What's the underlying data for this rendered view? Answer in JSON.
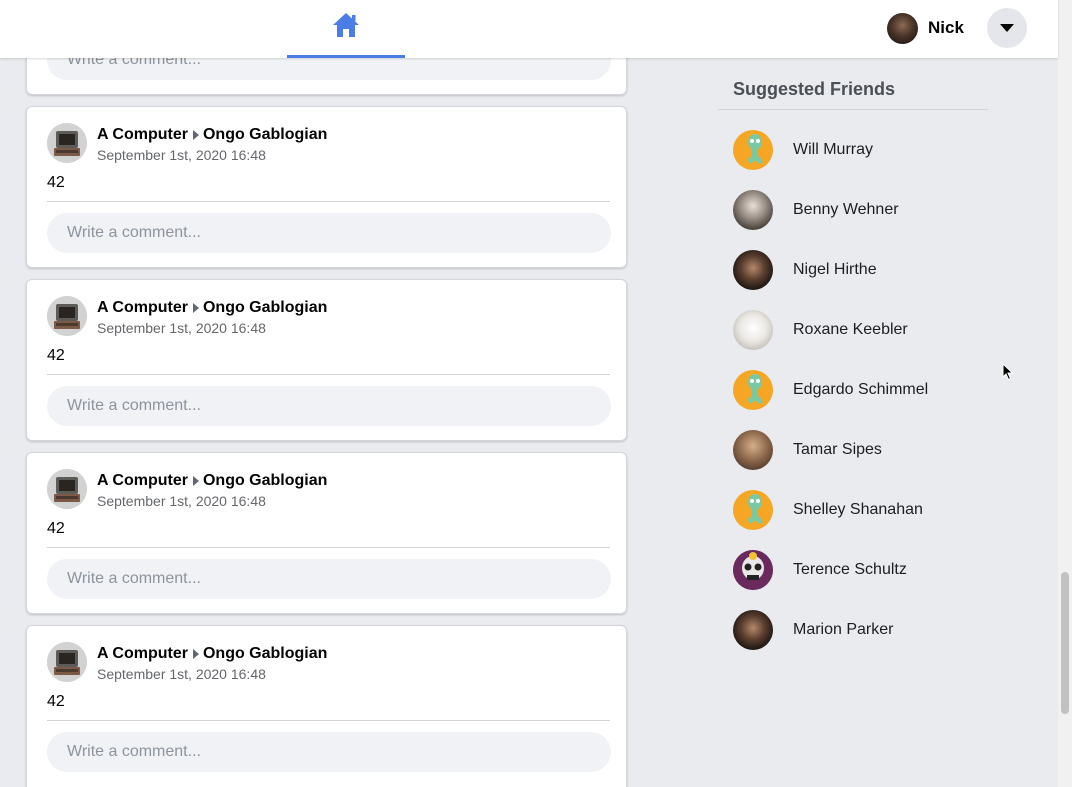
{
  "header": {
    "home_icon": "home-icon",
    "user_name": "Nick",
    "menu_icon": "caret-down-icon",
    "accent_color": "#4a7ee6"
  },
  "feed": {
    "partial_post": {
      "comment_placeholder": "Write a comment..."
    },
    "posts": [
      {
        "author": "A Computer",
        "recipient": "Ongo Gablogian",
        "date": "September 1st, 2020 16:48",
        "body": "42",
        "comment_placeholder": "Write a comment..."
      },
      {
        "author": "A Computer",
        "recipient": "Ongo Gablogian",
        "date": "September 1st, 2020 16:48",
        "body": "42",
        "comment_placeholder": "Write a comment..."
      },
      {
        "author": "A Computer",
        "recipient": "Ongo Gablogian",
        "date": "September 1st, 2020 16:48",
        "body": "42",
        "comment_placeholder": "Write a comment..."
      },
      {
        "author": "A Computer",
        "recipient": "Ongo Gablogian",
        "date": "September 1st, 2020 16:48",
        "body": "42",
        "comment_placeholder": "Write a comment..."
      }
    ]
  },
  "sidebar": {
    "title": "Suggested Friends",
    "friends": [
      {
        "name": "Will Murray",
        "avatar": "squidward-avatar"
      },
      {
        "name": "Benny Wehner",
        "avatar": "photo-avatar"
      },
      {
        "name": "Nigel Hirthe",
        "avatar": "dark-portrait-avatar"
      },
      {
        "name": "Roxane Keebler",
        "avatar": "white-portrait-avatar"
      },
      {
        "name": "Edgardo Schimmel",
        "avatar": "squidward-avatar"
      },
      {
        "name": "Tamar Sipes",
        "avatar": "brown-portrait-avatar"
      },
      {
        "name": "Shelley Shanahan",
        "avatar": "squidward-avatar"
      },
      {
        "name": "Terence Schultz",
        "avatar": "skull-avatar"
      },
      {
        "name": "Marion Parker",
        "avatar": "dark-portrait-avatar"
      }
    ]
  }
}
